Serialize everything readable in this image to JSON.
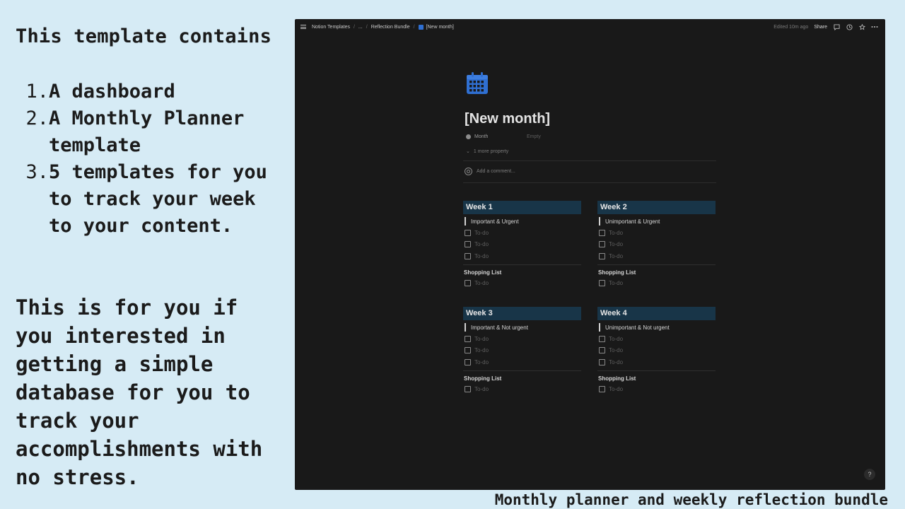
{
  "promo": {
    "heading": "This template contains",
    "features": [
      {
        "num": "1.",
        "text": "A dashboard"
      },
      {
        "num": "2.",
        "text": "A Monthly Planner template"
      },
      {
        "num": "3.",
        "text": "5 templates for you to track your week to your content."
      }
    ],
    "audience": "This is for you if you interested in getting a simple database for you to track your accomplishments with no stress.",
    "caption": "Monthly planner and weekly reflection bundle"
  },
  "notion": {
    "breadcrumb": {
      "root": "Notion Templates",
      "ellipsis": "...",
      "parent": "Reflection Bundle",
      "current": "[New month]"
    },
    "topbar": {
      "edited": "Edited 10m ago",
      "share": "Share"
    },
    "page": {
      "icon": "calendar-icon",
      "title": "[New month]",
      "property_label": "Month",
      "property_value": "Empty",
      "more_property": "1 more property",
      "comment_placeholder": "Add a comment..."
    },
    "weeks": [
      {
        "title": "Week 1",
        "quadrant": "Important & Urgent",
        "todos": [
          "To-do",
          "To-do",
          "To-do"
        ],
        "shopping_title": "Shopping List",
        "shopping": [
          "To-do"
        ]
      },
      {
        "title": "Week 2",
        "quadrant": "Unimportant & Urgent",
        "todos": [
          "To-do",
          "To-do",
          "To-do"
        ],
        "shopping_title": "Shopping List",
        "shopping": [
          "To-do"
        ]
      },
      {
        "title": "Week 3",
        "quadrant": "Important & Not urgent",
        "todos": [
          "To-do",
          "To-do",
          "To-do"
        ],
        "shopping_title": "Shopping List",
        "shopping": [
          "To-do"
        ]
      },
      {
        "title": "Week 4",
        "quadrant": "Unimportant & Not urgent",
        "todos": [
          "To-do",
          "To-do",
          "To-do"
        ],
        "shopping_title": "Shopping List",
        "shopping": [
          "To-do"
        ]
      }
    ],
    "help": "?"
  },
  "colors": {
    "background": "#d6ebf5",
    "window": "#191919",
    "week_header": "#183548",
    "calendar_icon": "#2f6fd1"
  }
}
